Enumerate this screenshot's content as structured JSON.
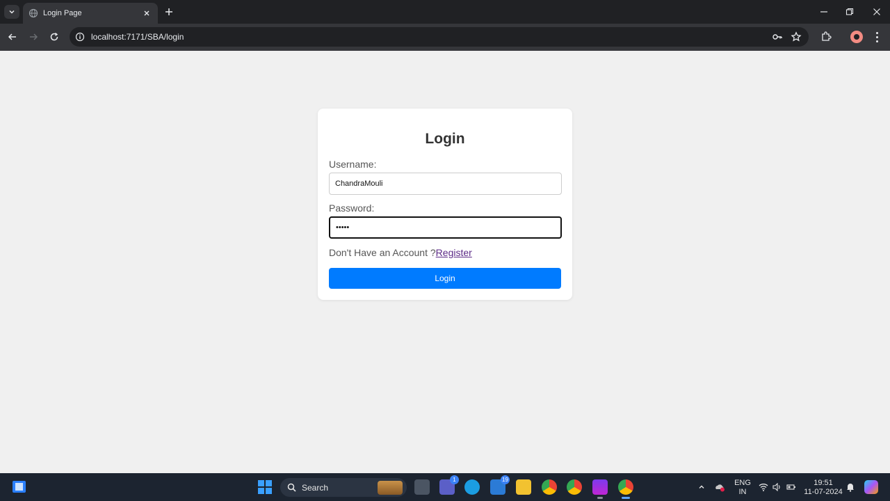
{
  "browser": {
    "tab_title": "Login Page",
    "url": "localhost:7171/SBA/login"
  },
  "page": {
    "heading": "Login",
    "username_label": "Username:",
    "username_value": "ChandraMouli",
    "password_label": "Password:",
    "password_value": "•••••",
    "register_prompt": "Don't Have an Account ?",
    "register_link": "Register",
    "login_button": "Login"
  },
  "taskbar": {
    "search_label": "Search",
    "teams_badge": "1",
    "mail_badge": "19",
    "language_top": "ENG",
    "language_bottom": "IN",
    "time": "19:51",
    "date": "11-07-2024"
  },
  "colors": {
    "primary_button": "#007bff",
    "link": "#5b2a86",
    "page_background": "#f0f0f0"
  }
}
